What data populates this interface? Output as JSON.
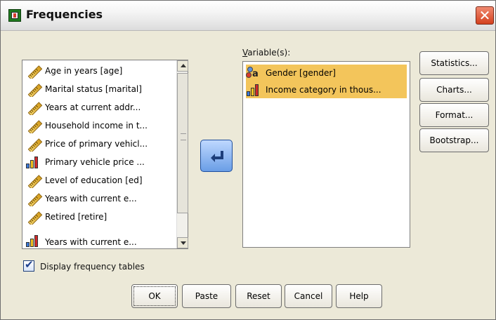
{
  "window": {
    "title": "Frequencies",
    "close_icon": "close-icon",
    "app_icon": "frequencies-app-icon"
  },
  "source_list": {
    "items": [
      {
        "label": "Age in years [age]",
        "icon": "scale-icon"
      },
      {
        "label": "Marital status [marital]",
        "icon": "scale-icon"
      },
      {
        "label": "Years at current addr...",
        "icon": "scale-icon"
      },
      {
        "label": "Household income in t...",
        "icon": "scale-icon"
      },
      {
        "label": "Price of primary vehicl...",
        "icon": "scale-icon"
      },
      {
        "label": "Primary vehicle price ...",
        "icon": "ordinal-icon"
      },
      {
        "label": "Level of education [ed]",
        "icon": "scale-icon"
      },
      {
        "label": "Years with current e...",
        "icon": "scale-icon"
      },
      {
        "label": "Retired [retire]",
        "icon": "scale-icon"
      },
      {
        "label": "Years with current e...",
        "icon": "ordinal-icon"
      }
    ]
  },
  "variables": {
    "label": "Variable(s):",
    "items": [
      {
        "label": "Gender [gender]",
        "icon": "nominal-icon"
      },
      {
        "label": "Income category in thous...",
        "icon": "ordinal-icon"
      }
    ]
  },
  "side_buttons": {
    "statistics": "Statistics...",
    "charts": "Charts...",
    "format": "Format...",
    "bootstrap": "Bootstrap..."
  },
  "checkbox": {
    "label": "Display frequency tables",
    "checked": true
  },
  "bottom_buttons": {
    "ok": "OK",
    "paste": "Paste",
    "reset": "Reset",
    "cancel": "Cancel",
    "help": "Help"
  },
  "colors": {
    "dialog_bg": "#ece9d8",
    "selection_bg": "#f3c55b",
    "move_button": "#6a9ee6"
  }
}
